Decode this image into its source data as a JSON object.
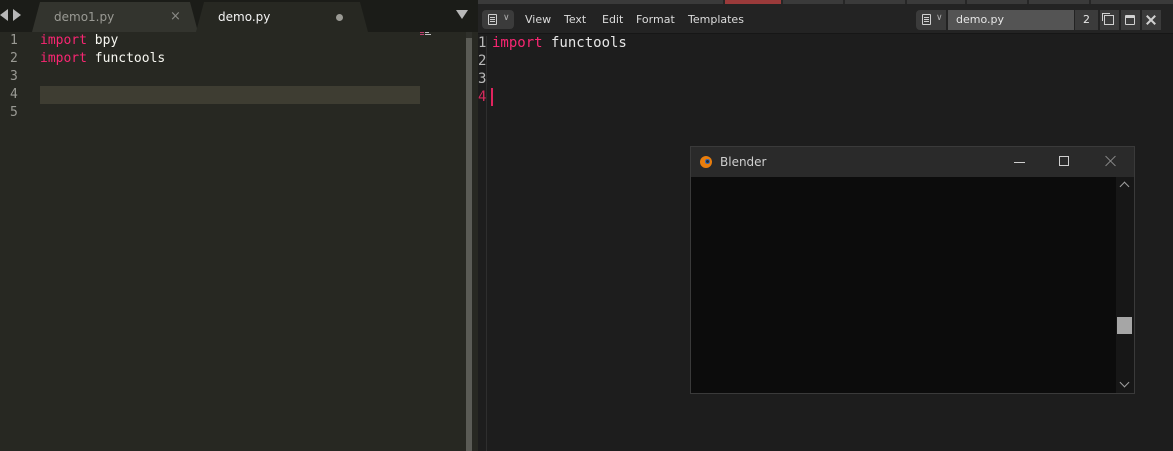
{
  "sublime": {
    "tabs": [
      {
        "label": "demo1.py",
        "close_glyph": "×"
      },
      {
        "label": "demo.py"
      }
    ],
    "line_numbers": [
      "1",
      "2",
      "3",
      "4",
      "5"
    ],
    "code": [
      {
        "keyword": "import",
        "rest": " bpy"
      },
      {
        "keyword": "import",
        "rest": " functools"
      },
      {
        "keyword": "",
        "rest": ""
      },
      {
        "keyword": "",
        "rest": ""
      },
      {
        "keyword": "",
        "rest": ""
      }
    ]
  },
  "blender": {
    "menu": [
      "View",
      "Text",
      "Edit",
      "Format",
      "Templates"
    ],
    "text_block": {
      "name": "demo.py",
      "users": "2"
    },
    "line_numbers": [
      "1",
      "2",
      "3",
      "4"
    ],
    "code": [
      {
        "keyword": "import",
        "rest": " functools"
      },
      {
        "keyword": "",
        "rest": ""
      },
      {
        "keyword": "",
        "rest": ""
      },
      {
        "keyword": "",
        "rest": ""
      }
    ]
  },
  "console": {
    "title": "Blender"
  },
  "colors": {
    "keyword": "#f92672",
    "accent": "#e0245e",
    "blender_orange": "#e87d0d"
  }
}
